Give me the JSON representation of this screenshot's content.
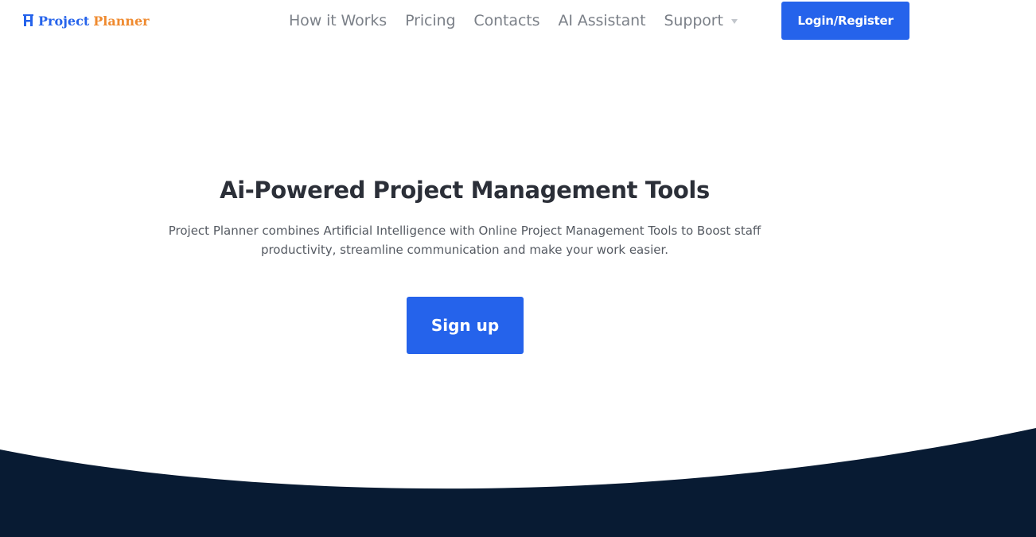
{
  "logo": {
    "icon": "pp-logo-icon",
    "word1": "Project",
    "word2": "Planner",
    "colors": {
      "word1": "#2563eb",
      "word2": "#ef8a2f"
    }
  },
  "nav": {
    "items": [
      {
        "label": "How it Works"
      },
      {
        "label": "Pricing"
      },
      {
        "label": "Contacts"
      },
      {
        "label": "AI Assistant"
      },
      {
        "label": "Support",
        "has_dropdown": true
      }
    ],
    "login_label": "Login/Register"
  },
  "hero": {
    "title": "Ai-Powered Project Management Tools",
    "subtitle": "Project Planner combines Artificial Intelligence with Online Project Management Tools to Boost staff productivity, streamline communication and make your work easier.",
    "cta_label": "Sign up"
  },
  "colors": {
    "accent": "#2563eb",
    "footer_band": "#081b33",
    "title_text": "#2b2f38",
    "nav_text": "#7b8088"
  }
}
